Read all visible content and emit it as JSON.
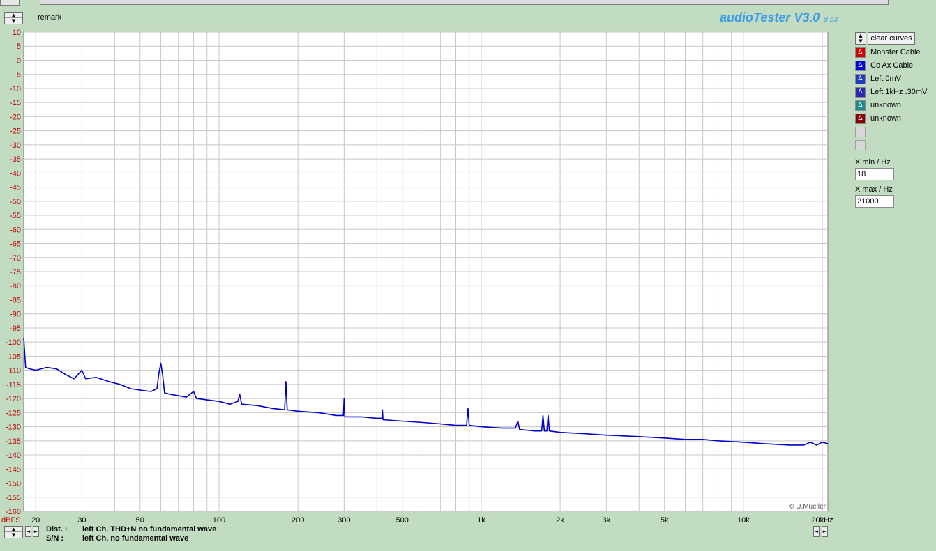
{
  "remark_label": "remark",
  "app": {
    "title": "audioTester V3.0",
    "version": "B b3",
    "copyright": "© U.Mueller"
  },
  "controls": {
    "clear_curves": "clear curves",
    "spin_up": "▲",
    "spin_down": "▼",
    "nav_left": "◄",
    "nav_right": "►"
  },
  "legend": [
    {
      "label": "Monster Cable",
      "color": "#d40000",
      "icon": "triangle-icon"
    },
    {
      "label": "Co Ax Cable",
      "color": "#0000e0",
      "icon": "triangle-icon"
    },
    {
      "label": "Left 0mV",
      "color": "#1e3cc0",
      "icon": "triangle-icon"
    },
    {
      "label": "Left 1kHz .30mV",
      "color": "#2a2ab0",
      "icon": "triangle-icon"
    },
    {
      "label": "unknown",
      "color": "#1a8a8a",
      "icon": "triangle-icon"
    },
    {
      "label": "unknown",
      "color": "#8a0000",
      "icon": "triangle-icon"
    },
    {
      "label": "",
      "color": "#d8d8d8",
      "icon": ""
    },
    {
      "label": "",
      "color": "#d8d8d8",
      "icon": ""
    }
  ],
  "xrange": {
    "min_label": "X min / Hz",
    "min_value": "18",
    "max_label": "X max / Hz",
    "max_value": "21000"
  },
  "status": {
    "dist_label": "Dist. :",
    "dist_value": "left Ch. THD+N  no fundamental wave",
    "sn_label": "S/N :",
    "sn_value": "left Ch.  no fundamental wave"
  },
  "chart_data": {
    "type": "line",
    "ylabel": "dBFS",
    "xlim": [
      18,
      21000
    ],
    "xscale": "log",
    "ylim": [
      -160,
      10
    ],
    "grid": true,
    "y_ticks": [
      10,
      5,
      0,
      -5,
      -10,
      -15,
      -20,
      -25,
      -30,
      -35,
      -40,
      -45,
      -50,
      -55,
      -60,
      -65,
      -70,
      -75,
      -80,
      -85,
      -90,
      -95,
      -100,
      -105,
      -110,
      -115,
      -120,
      -125,
      -130,
      -135,
      -140,
      -145,
      -150,
      -155,
      -160
    ],
    "x_ticks": [
      {
        "value": 20,
        "label": "20"
      },
      {
        "value": 30,
        "label": "30"
      },
      {
        "value": 50,
        "label": "50"
      },
      {
        "value": 100,
        "label": "100"
      },
      {
        "value": 200,
        "label": "200"
      },
      {
        "value": 300,
        "label": "300"
      },
      {
        "value": 500,
        "label": "500"
      },
      {
        "value": 1000,
        "label": "1k"
      },
      {
        "value": 2000,
        "label": "2k"
      },
      {
        "value": 3000,
        "label": "3k"
      },
      {
        "value": 5000,
        "label": "5k"
      },
      {
        "value": 10000,
        "label": "10k"
      },
      {
        "value": 20000,
        "label": "20kHz"
      }
    ],
    "series": [
      {
        "name": "Left 1kHz .30mV",
        "color": "#0000c8",
        "points": [
          [
            18,
            -98.5
          ],
          [
            18.3,
            -109
          ],
          [
            19,
            -109.5
          ],
          [
            20,
            -110
          ],
          [
            22,
            -109
          ],
          [
            24,
            -109.5
          ],
          [
            26,
            -111.5
          ],
          [
            28,
            -113
          ],
          [
            30,
            -110
          ],
          [
            31,
            -113
          ],
          [
            34,
            -112.5
          ],
          [
            38,
            -114
          ],
          [
            42,
            -115
          ],
          [
            46,
            -116.5
          ],
          [
            50,
            -117
          ],
          [
            55,
            -117.5
          ],
          [
            58,
            -116.5
          ],
          [
            59,
            -111
          ],
          [
            60,
            -107.5
          ],
          [
            61,
            -112
          ],
          [
            62,
            -118
          ],
          [
            65,
            -118.5
          ],
          [
            70,
            -119
          ],
          [
            75,
            -119.5
          ],
          [
            80,
            -117.5
          ],
          [
            82,
            -120
          ],
          [
            90,
            -120.5
          ],
          [
            100,
            -121
          ],
          [
            110,
            -122
          ],
          [
            118,
            -121
          ],
          [
            120,
            -118.5
          ],
          [
            122,
            -122
          ],
          [
            140,
            -122.5
          ],
          [
            160,
            -123.5
          ],
          [
            178,
            -124
          ],
          [
            180,
            -114
          ],
          [
            182,
            -124
          ],
          [
            200,
            -124.5
          ],
          [
            240,
            -125
          ],
          [
            280,
            -126
          ],
          [
            298,
            -126
          ],
          [
            300,
            -120
          ],
          [
            302,
            -126.5
          ],
          [
            350,
            -126.5
          ],
          [
            400,
            -127
          ],
          [
            418,
            -127
          ],
          [
            420,
            -124
          ],
          [
            422,
            -127.5
          ],
          [
            500,
            -128
          ],
          [
            600,
            -128.5
          ],
          [
            700,
            -129
          ],
          [
            800,
            -129.5
          ],
          [
            880,
            -129.5
          ],
          [
            890,
            -123.5
          ],
          [
            900,
            -129.5
          ],
          [
            1000,
            -130
          ],
          [
            1200,
            -130.5
          ],
          [
            1350,
            -130.5
          ],
          [
            1380,
            -128
          ],
          [
            1400,
            -131
          ],
          [
            1600,
            -131.5
          ],
          [
            1700,
            -131.5
          ],
          [
            1720,
            -126
          ],
          [
            1740,
            -131.5
          ],
          [
            1780,
            -131.5
          ],
          [
            1800,
            -126
          ],
          [
            1820,
            -131.5
          ],
          [
            2000,
            -132
          ],
          [
            2500,
            -132.5
          ],
          [
            3000,
            -133
          ],
          [
            4000,
            -133.5
          ],
          [
            5000,
            -134
          ],
          [
            6000,
            -134.5
          ],
          [
            7000,
            -134.5
          ],
          [
            8000,
            -135
          ],
          [
            10000,
            -135.5
          ],
          [
            12000,
            -136
          ],
          [
            15000,
            -136.5
          ],
          [
            17000,
            -136.5
          ],
          [
            18000,
            -135.5
          ],
          [
            19000,
            -136.5
          ],
          [
            20000,
            -135.5
          ],
          [
            21000,
            -136
          ]
        ]
      }
    ]
  }
}
